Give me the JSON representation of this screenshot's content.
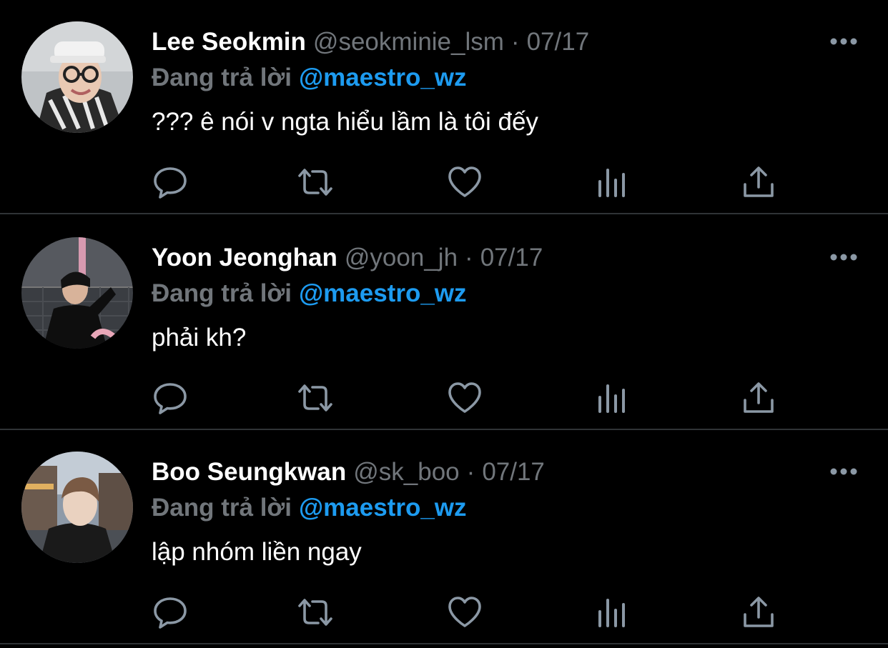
{
  "colors": {
    "background": "#000000",
    "name": "#ffffff",
    "muted": "#71767b",
    "accent": "#1d9bf0",
    "divider": "#2f3336",
    "icon": "#8b98a5"
  },
  "icons": {
    "more": "more-horizontal-icon",
    "reply": "reply-bubble-icon",
    "retweet": "retweet-icon",
    "like": "heart-icon",
    "stats": "analytics-bars-icon",
    "share": "share-upload-icon"
  },
  "tweets": [
    {
      "name": "Lee Seokmin",
      "handle": "@seokminie_lsm",
      "separator": "·",
      "date": "07/17",
      "reply_prefix": "Đang trả lời",
      "reply_to": "@maestro_wz",
      "text": "??? ê nói v ngta hiểu lầm là tôi đếy"
    },
    {
      "name": "Yoon Jeonghan",
      "handle": "@yoon_jh",
      "separator": "·",
      "date": "07/17",
      "reply_prefix": "Đang trả lời",
      "reply_to": "@maestro_wz",
      "text": "phải kh?"
    },
    {
      "name": "Boo Seungkwan",
      "handle": "@sk_boo",
      "separator": "·",
      "date": "07/17",
      "reply_prefix": "Đang trả lời",
      "reply_to": "@maestro_wz",
      "text": "lập nhóm liền ngay"
    }
  ]
}
